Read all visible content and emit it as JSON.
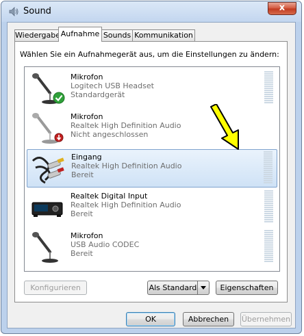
{
  "window": {
    "title": "Sound",
    "close_symbol": "x"
  },
  "tabs": [
    {
      "label": "Wiedergabe",
      "active": false
    },
    {
      "label": "Aufnahme",
      "active": true
    },
    {
      "label": "Sounds",
      "active": false
    },
    {
      "label": "Kommunikation",
      "active": false
    }
  ],
  "instruction": "Wählen Sie ein Aufnahmegerät aus, um die Einstellungen zu ändern:",
  "devices": [
    {
      "name": "Mikrofon",
      "driver": "Logitech USB Headset",
      "status": "Standardgerät",
      "icon": "microphone-icon",
      "badge": "default-check-icon"
    },
    {
      "name": "Mikrofon",
      "driver": "Realtek High Definition Audio",
      "status": "Nicht angeschlossen",
      "icon": "microphone-icon",
      "badge": "unplugged-icon"
    },
    {
      "name": "Eingang",
      "driver": "Realtek High Definition Audio",
      "status": "Bereit",
      "icon": "rca-cable-icon",
      "selected": true
    },
    {
      "name": "Realtek Digital Input",
      "driver": "Realtek High Definition Audio",
      "status": "Bereit",
      "icon": "digital-receiver-icon"
    },
    {
      "name": "Mikrofon",
      "driver": "USB Audio CODEC",
      "status": "Bereit",
      "icon": "microphone-icon"
    }
  ],
  "buttons": {
    "configure": "Konfigurieren",
    "set_default": "Als Standard",
    "properties": "Eigenschaften",
    "ok": "OK",
    "cancel": "Abbrechen",
    "apply": "Übernehmen"
  },
  "colors": {
    "selection": "#cfe2f6",
    "annotation_arrow": "#ffff00",
    "close_button": "#c0391f"
  }
}
